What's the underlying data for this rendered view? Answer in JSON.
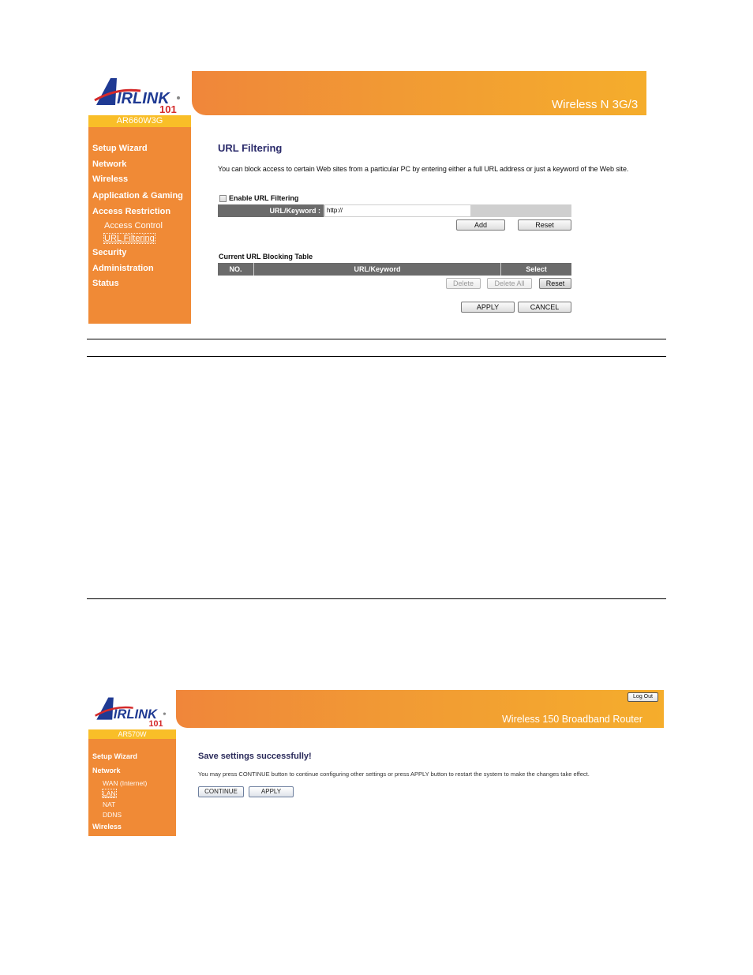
{
  "screen1": {
    "brand": {
      "logo_text": "AIRLINK",
      "logo_sub": "101",
      "model": "AR660W3G"
    },
    "header_title": "Wireless N 3G/3",
    "sidebar": {
      "items": [
        {
          "label": "Setup Wizard"
        },
        {
          "label": "Network"
        },
        {
          "label": "Wireless"
        },
        {
          "label": "Application & Gaming"
        },
        {
          "label": "Access Restriction"
        },
        {
          "label": "Access Control",
          "sub": true
        },
        {
          "label": "URL Filtering",
          "sub": true,
          "active": true
        },
        {
          "label": "Security"
        },
        {
          "label": "Administration"
        },
        {
          "label": "Status"
        }
      ]
    },
    "main": {
      "title": "URL Filtering",
      "description": "You can block access to certain Web sites from a particular PC by entering either a full URL address or just a keyword of the Web site.",
      "enable_label": "Enable URL Filtering",
      "enable_checked": false,
      "url_label": "URL/Keyword :",
      "url_value": "http://",
      "add_label": "Add",
      "reset_label": "Reset",
      "table_title": "Current URL Blocking Table",
      "table_columns": [
        "NO.",
        "URL/Keyword",
        "Select"
      ],
      "table_rows": [],
      "delete_label": "Delete",
      "delete_all_label": "Delete All",
      "table_reset_label": "Reset",
      "apply_label": "APPLY",
      "cancel_label": "CANCEL"
    }
  },
  "screen2": {
    "brand": {
      "logo_text": "AIRLINK",
      "logo_sub": "101",
      "model": "AR570W"
    },
    "header_title": "Wireless 150 Broadband Router",
    "logout_label": "Log Out",
    "sidebar": {
      "items": [
        {
          "label": "Setup Wizard"
        },
        {
          "label": "Network"
        },
        {
          "label": "WAN (Internet)",
          "sub": true
        },
        {
          "label": "LAN",
          "sub": true,
          "active": true
        },
        {
          "label": "NAT",
          "sub": true
        },
        {
          "label": "DDNS",
          "sub": true
        },
        {
          "label": "Wireless"
        }
      ]
    },
    "main": {
      "title": "Save settings successfully!",
      "description": "You may press CONTINUE button to continue configuring other settings or press APPLY button to restart the system to make the changes take effect.",
      "continue_label": "CONTINUE",
      "apply_label": "APPLY"
    }
  },
  "colors": {
    "sidebar": "#f08a36",
    "model_bar": "#f9be28",
    "header_start": "#f0863a",
    "header_end": "#f5ad2c",
    "table_header": "#6b6b6b",
    "title_text": "#2a2a6a"
  }
}
